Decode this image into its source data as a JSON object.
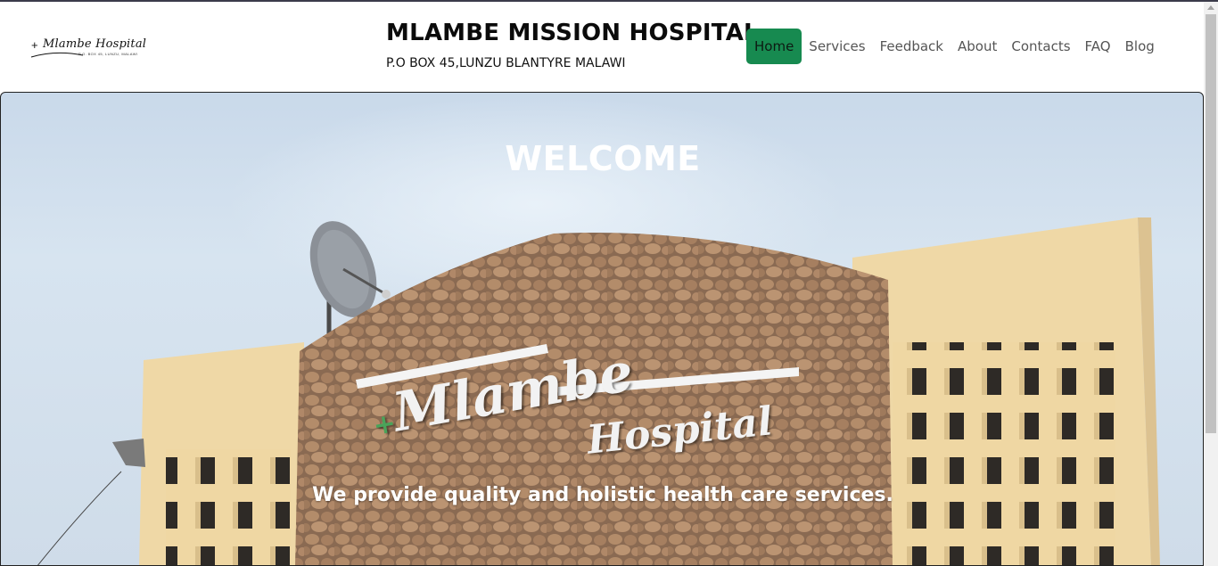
{
  "logo": {
    "text": "Mlambe Hospital",
    "subtext": "P.O. BOX 45, LUNZU, MALAWI",
    "cross": "+"
  },
  "header": {
    "title": "MLAMBE MISSION HOSPITAL",
    "subtitle": "P.O BOX 45,LUNZU BLANTYRE MALAWI"
  },
  "nav": {
    "items": [
      {
        "label": "Home",
        "active": true
      },
      {
        "label": "Services"
      },
      {
        "label": "Feedback"
      },
      {
        "label": "About"
      },
      {
        "label": "Contacts"
      },
      {
        "label": "FAQ"
      },
      {
        "label": "Blog"
      }
    ]
  },
  "hero": {
    "title": "WELCOME",
    "tagline": "We provide quality and holistic health care services.",
    "sign_word1": "Mlambe",
    "sign_word2": "Hospital",
    "sign_cross": "+"
  },
  "colors": {
    "accent": "#178a50",
    "stone": "#9a7a5e",
    "wall": "#eed9a8",
    "sky": "#d3e0ed"
  }
}
